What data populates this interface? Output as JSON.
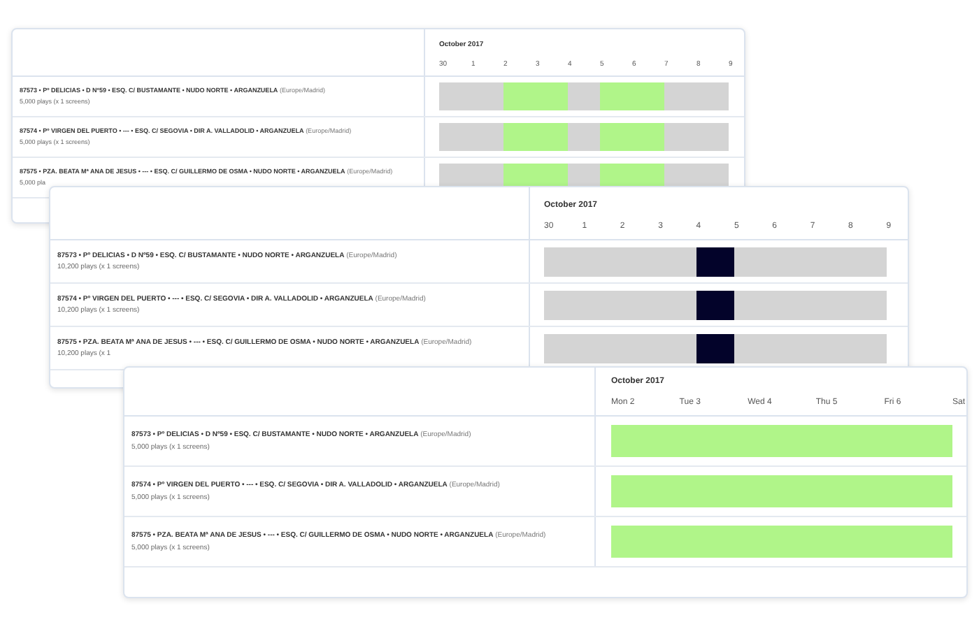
{
  "schedules": [
    {
      "month": "October 2017",
      "days": [
        "30",
        "1",
        "2",
        "3",
        "4",
        "5",
        "6",
        "7",
        "8",
        "9"
      ],
      "rows": [
        {
          "title": "87573 • Pº DELICIAS • D Nº59 • ESQ. C/ BUSTAMANTE • NUDO NORTE • ARGANZUELA",
          "timezone": "(Europe/Madrid)",
          "plays": "5,000 plays (x 1 screens)",
          "slots": [
            {
              "color": "#d4d4d4"
            },
            {
              "color": "#d4d4d4"
            },
            {
              "color": "#b0f589"
            },
            {
              "color": "#b0f589"
            },
            {
              "color": "#d4d4d4"
            },
            {
              "color": "#b0f589"
            },
            {
              "color": "#b0f589"
            },
            {
              "color": "#d4d4d4"
            },
            {
              "color": "#d4d4d4"
            }
          ]
        },
        {
          "title": "87574 • Pº VIRGEN DEL PUERTO • --- • ESQ. C/ SEGOVIA • DIR A. VALLADOLID • ARGANZUELA",
          "timezone": "(Europe/Madrid)",
          "plays": "5,000 plays (x 1 screens)",
          "slots": [
            {
              "color": "#d4d4d4"
            },
            {
              "color": "#d4d4d4"
            },
            {
              "color": "#b0f589"
            },
            {
              "color": "#b0f589"
            },
            {
              "color": "#d4d4d4"
            },
            {
              "color": "#b0f589"
            },
            {
              "color": "#b0f589"
            },
            {
              "color": "#d4d4d4"
            },
            {
              "color": "#d4d4d4"
            }
          ]
        },
        {
          "title": "87575 • PZA. BEATA Mª ANA DE JESUS • --- • ESQ. C/ GUILLERMO DE OSMA • NUDO NORTE • ARGANZUELA",
          "timezone": "(Europe/Madrid)",
          "plays": "5,000 pla",
          "slots": [
            {
              "color": "#d4d4d4"
            },
            {
              "color": "#d4d4d4"
            },
            {
              "color": "#b0f589"
            },
            {
              "color": "#b0f589"
            },
            {
              "color": "#d4d4d4"
            },
            {
              "color": "#b0f589"
            },
            {
              "color": "#b0f589"
            },
            {
              "color": "#d4d4d4"
            },
            {
              "color": "#d4d4d4"
            }
          ]
        }
      ]
    },
    {
      "month": "October 2017",
      "days": [
        "30",
        "1",
        "2",
        "3",
        "4",
        "5",
        "6",
        "7",
        "8",
        "9"
      ],
      "rows": [
        {
          "title": "87573 • Pº DELICIAS • D Nº59 • ESQ. C/ BUSTAMANTE • NUDO NORTE • ARGANZUELA",
          "timezone": "(Europe/Madrid)",
          "plays": "10,200 plays (x 1 screens)",
          "slots": [
            {
              "color": "#d4d4d4"
            },
            {
              "color": "#d4d4d4"
            },
            {
              "color": "#d4d4d4"
            },
            {
              "color": "#d4d4d4"
            },
            {
              "color": "#03032a"
            },
            {
              "color": "#d4d4d4"
            },
            {
              "color": "#d4d4d4"
            },
            {
              "color": "#d4d4d4"
            },
            {
              "color": "#d4d4d4"
            }
          ]
        },
        {
          "title": "87574 • Pº VIRGEN DEL PUERTO • --- • ESQ. C/ SEGOVIA • DIR A. VALLADOLID • ARGANZUELA",
          "timezone": "(Europe/Madrid)",
          "plays": "10,200 plays (x 1 screens)",
          "slots": [
            {
              "color": "#d4d4d4"
            },
            {
              "color": "#d4d4d4"
            },
            {
              "color": "#d4d4d4"
            },
            {
              "color": "#d4d4d4"
            },
            {
              "color": "#03032a"
            },
            {
              "color": "#d4d4d4"
            },
            {
              "color": "#d4d4d4"
            },
            {
              "color": "#d4d4d4"
            },
            {
              "color": "#d4d4d4"
            }
          ]
        },
        {
          "title": "87575 • PZA. BEATA Mª ANA DE JESUS • --- • ESQ. C/ GUILLERMO DE OSMA • NUDO NORTE • ARGANZUELA",
          "timezone": "(Europe/Madrid)",
          "plays": "10,200 plays (x 1",
          "slots": [
            {
              "color": "#d4d4d4"
            },
            {
              "color": "#d4d4d4"
            },
            {
              "color": "#d4d4d4"
            },
            {
              "color": "#d4d4d4"
            },
            {
              "color": "#03032a"
            },
            {
              "color": "#d4d4d4"
            },
            {
              "color": "#d4d4d4"
            },
            {
              "color": "#d4d4d4"
            },
            {
              "color": "#d4d4d4"
            }
          ]
        }
      ]
    },
    {
      "month": "October 2017",
      "days": [
        "Mon 2",
        "Tue 3",
        "Wed 4",
        "Thu 5",
        "Fri 6",
        "Sat"
      ],
      "rows": [
        {
          "title": "87573 • Pº DELICIAS • D Nº59 • ESQ. C/ BUSTAMANTE • NUDO NORTE • ARGANZUELA",
          "timezone": "(Europe/Madrid)",
          "plays": "5,000 plays (x 1 screens)",
          "slots": [
            {
              "color": "#b0f589"
            },
            {
              "color": "#b0f589"
            },
            {
              "color": "#b0f589"
            },
            {
              "color": "#b0f589"
            },
            {
              "color": "#b0f589"
            }
          ]
        },
        {
          "title": "87574 • Pº VIRGEN DEL PUERTO • --- • ESQ. C/ SEGOVIA • DIR A. VALLADOLID • ARGANZUELA",
          "timezone": "(Europe/Madrid)",
          "plays": "5,000 plays (x 1 screens)",
          "slots": [
            {
              "color": "#b0f589"
            },
            {
              "color": "#b0f589"
            },
            {
              "color": "#b0f589"
            },
            {
              "color": "#b0f589"
            },
            {
              "color": "#b0f589"
            }
          ]
        },
        {
          "title": "87575 • PZA. BEATA Mª ANA DE JESUS • --- • ESQ. C/ GUILLERMO DE OSMA • NUDO NORTE • ARGANZUELA",
          "timezone": "(Europe/Madrid)",
          "plays": "5,000 plays (x 1 screens)",
          "slots": [
            {
              "color": "#b0f589"
            },
            {
              "color": "#b0f589"
            },
            {
              "color": "#b0f589"
            },
            {
              "color": "#b0f589"
            },
            {
              "color": "#b0f589"
            }
          ]
        }
      ]
    }
  ]
}
